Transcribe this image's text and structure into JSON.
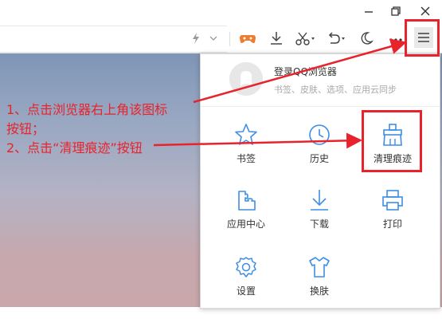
{
  "titlebar": {
    "minimize_icon": "minimize-icon",
    "restore_icon": "restore-icon",
    "close_icon": "close-icon"
  },
  "toolbar": {
    "icons": [
      "lightning-icon",
      "chevron-down-icon",
      "game-icon",
      "download-icon",
      "scissors-icon",
      "undo-icon",
      "moon-icon",
      "more-icon",
      "menu-icon"
    ]
  },
  "menu": {
    "login_title": "登录QQ浏览器",
    "login_subtitle": "书签、皮肤、选项、应用云同步",
    "items": [
      {
        "label": "书签",
        "icon": "star-icon"
      },
      {
        "label": "历史",
        "icon": "clock-icon"
      },
      {
        "label": "清理痕迹",
        "icon": "broom-icon"
      },
      {
        "label": "应用中心",
        "icon": "puzzle-icon"
      },
      {
        "label": "下载",
        "icon": "download-icon"
      },
      {
        "label": "打印",
        "icon": "printer-icon"
      },
      {
        "label": "设置",
        "icon": "gear-icon"
      },
      {
        "label": "换肤",
        "icon": "shirt-icon"
      }
    ]
  },
  "annotation": {
    "line1": "1、点击浏览器右上角该图标",
    "line2": "按钮；",
    "line3": "2、点击“清理痕迹”按钮"
  },
  "colors": {
    "accent_blue": "#3d8ee6",
    "annotation_red": "#e8232b"
  }
}
